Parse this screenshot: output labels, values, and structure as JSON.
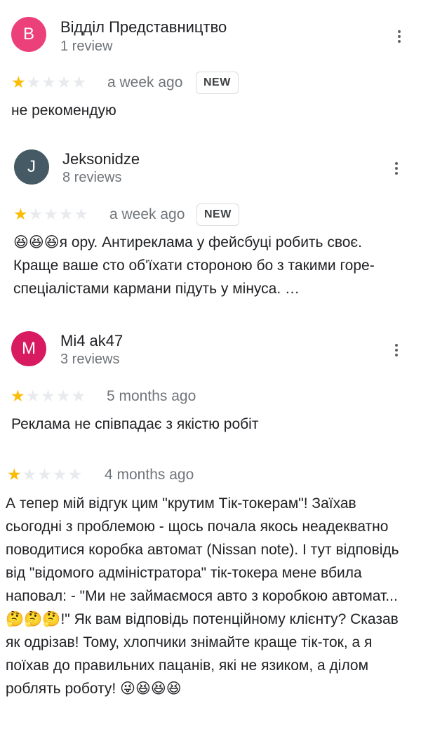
{
  "colors": {
    "avatar_1": "#ec407a",
    "avatar_2": "#455a64",
    "avatar_3": "#d81b60",
    "star_filled": "#fbbc04",
    "star_empty": "#e8eaed"
  },
  "icons": {
    "menu": "more-vert-icon",
    "star": "star-icon"
  },
  "reviews": [
    {
      "avatar_letter": "В",
      "author": "Відділ Представництво",
      "review_count": "1 review",
      "rating": 1,
      "time": "a week ago",
      "badge": "NEW",
      "text": "не рекомендую"
    },
    {
      "avatar_letter": "J",
      "author": "Jeksonidze",
      "review_count": "8 reviews",
      "rating": 1,
      "time": "a week ago",
      "badge": "NEW",
      "text": "😆😆😆я ору. Антиреклама у фейсбуці робить своє. Краще ваше сто об'їхати стороною бо з такими горе-спеціалістами кармани підуть у мінуса. …"
    },
    {
      "avatar_letter": "M",
      "author": "Mi4 ak47",
      "review_count": "3 reviews",
      "rating": 1,
      "time": "5 months ago",
      "text": "Реклама не співпадає з якістю робіт"
    },
    {
      "rating": 1,
      "time": "4 months ago",
      "text": "А тепер мій відгук цим \"крутим Тік-токерам\"! Заїхав сьогодні з проблемою - щось почала якось неадекватно поводитися коробка автомат (Nissan note). І тут відповідь від \"відомого адміністратора\" тік-токера мене вбила наповал: - \"Ми не займаємося авто з коробкою автомат...🤔🤔🤔!\" Як вам відповідь потенційному клієнту? Сказав як одрізав! Тому, хлопчики знімайте краще тік-ток, а я поїхав до правильних пацанів, які не язиком, а ділом роблять роботу! 😜😆😆😆"
    }
  ]
}
